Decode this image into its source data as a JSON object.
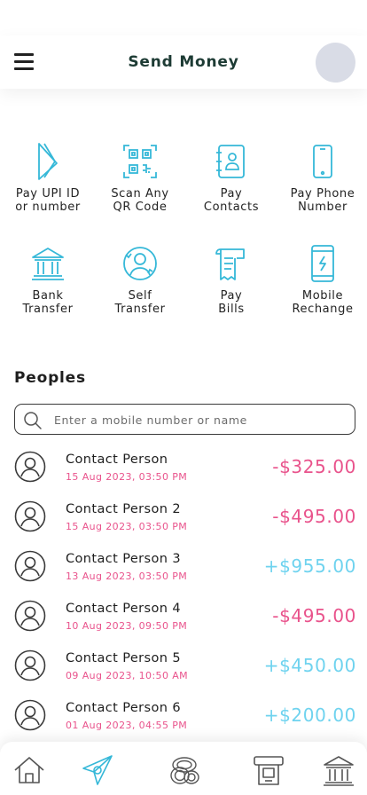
{
  "header": {
    "title": "Send Money"
  },
  "actions": [
    {
      "label": "Pay UPI ID\nor number",
      "icon": "upi-icon"
    },
    {
      "label": "Scan Any\nQR Code",
      "icon": "qr-code-icon"
    },
    {
      "label": "Pay\nContacts",
      "icon": "contacts-book-icon"
    },
    {
      "label": "Pay Phone\nNumber",
      "icon": "phone-icon"
    },
    {
      "label": "Bank\nTransfer",
      "icon": "bank-icon"
    },
    {
      "label": "Self\nTransfer",
      "icon": "self-transfer-icon"
    },
    {
      "label": "Pay\nBills",
      "icon": "bill-receipt-icon"
    },
    {
      "label": "Mobile\nRechange",
      "icon": "mobile-recharge-icon"
    }
  ],
  "peoples": {
    "title": "Peoples",
    "search_placeholder": "Enter a mobile number or name",
    "items": [
      {
        "name": "Contact Person",
        "date": "15 Aug 2023,  03:50 PM",
        "amount": "-$325.00",
        "type": "debit"
      },
      {
        "name": "Contact Person 2",
        "date": "15 Aug 2023,  03:50 PM",
        "amount": "-$495.00",
        "type": "debit"
      },
      {
        "name": "Contact Person 3",
        "date": "13 Aug 2023,  03:50 PM",
        "amount": "+$955.00",
        "type": "credit"
      },
      {
        "name": "Contact Person 4",
        "date": "10 Aug 2023,  09:50 PM",
        "amount": "-$495.00",
        "type": "debit"
      },
      {
        "name": "Contact Person 5",
        "date": "09 Aug 2023,  10:50 AM",
        "amount": "+$450.00",
        "type": "credit"
      },
      {
        "name": "Contact Person 6",
        "date": "01 Aug 2023,  04:55 PM",
        "amount": "+$200.00",
        "type": "credit"
      }
    ]
  },
  "tabbar": [
    "home-icon",
    "send-icon",
    "coins-icon",
    "atm-icon",
    "bank-icon"
  ],
  "colors": {
    "accent": "#35b8d8",
    "debit": "#e9538c",
    "credit": "#6fd3ef",
    "title": "#1d3b34"
  }
}
